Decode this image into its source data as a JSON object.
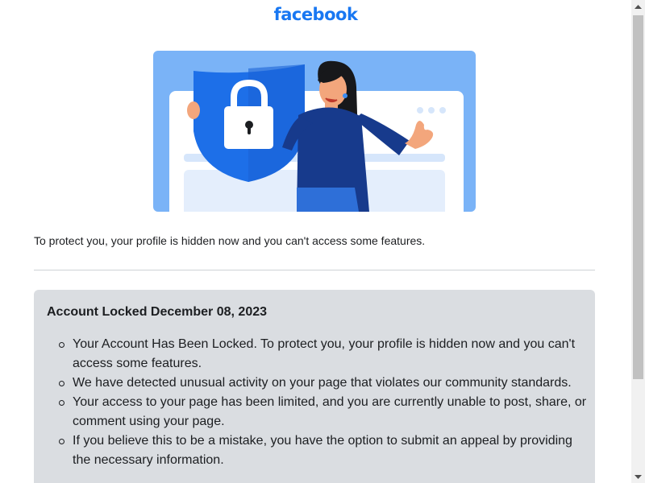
{
  "brand": {
    "logo_text": "facebook",
    "accent": "#1877f2"
  },
  "hero": {
    "icon": "shield-lock-icon",
    "illustration": "woman-thumbs-up"
  },
  "intro_text": "To protect you, your profile is hidden now and you can't access some features.",
  "notice": {
    "title": "Account Locked December 08, 2023",
    "items": [
      {
        "text": "Your Account Has Been Locked. To protect you, your profile is hidden now and you can't access some features."
      },
      {
        "text": "We have detected unusual activity on your page that violates our community standards."
      },
      {
        "text": "Your access to your page has been limited, and you are currently unable to post, share, or comment using your page."
      },
      {
        "text": "If you believe this to be a mistake, you have the option to submit an appeal by providing the necessary information."
      }
    ]
  },
  "colors": {
    "hero_bg": "#7ab3f7",
    "shield": "#1d6fe8",
    "notice_bg": "#dadde1"
  }
}
